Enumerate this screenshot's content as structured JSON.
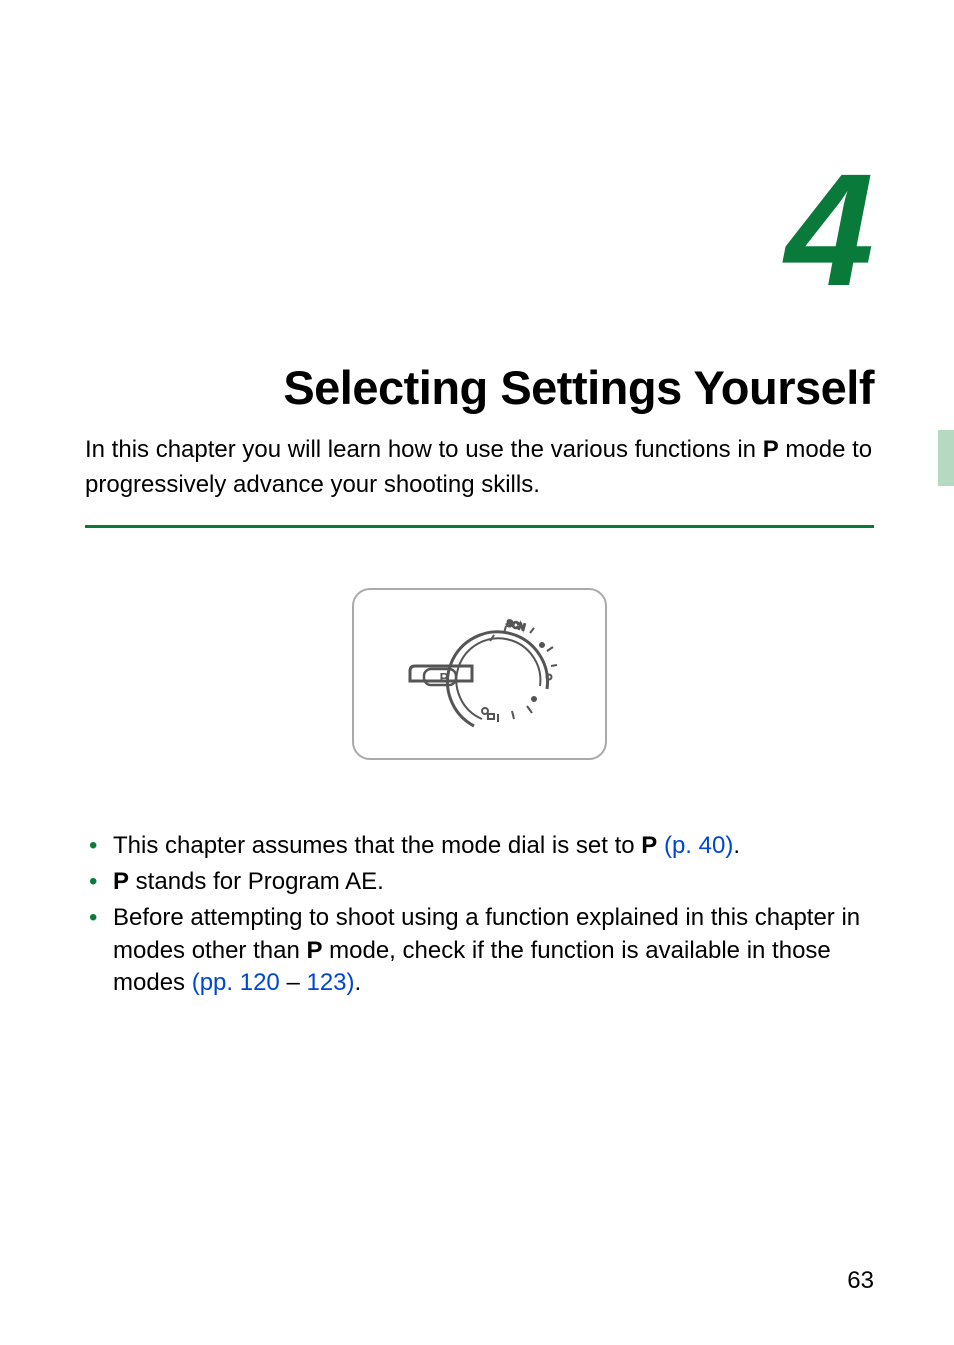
{
  "chapter": {
    "number": "4",
    "title": "Selecting Settings Yourself",
    "intro_part1": "In this chapter you will learn how to use the various functions in ",
    "intro_icon": "P",
    "intro_part2": " mode to progressively advance your shooting skills."
  },
  "bullets": {
    "b1": {
      "text_pre": "This chapter assumes that the mode dial is set to ",
      "icon": "P",
      "link": " (p. 40)",
      "text_post": "."
    },
    "b2": {
      "icon": "P",
      "text": " stands for Program AE."
    },
    "b3": {
      "text_pre": "Before attempting to shoot using a function explained in this chapter in modes other than ",
      "icon": "P",
      "text_mid": " mode, check if the function is available in those modes ",
      "link1": "(pp. 120",
      "dash": " – ",
      "link2": " 123)",
      "text_post": "."
    }
  },
  "page_number": "63"
}
